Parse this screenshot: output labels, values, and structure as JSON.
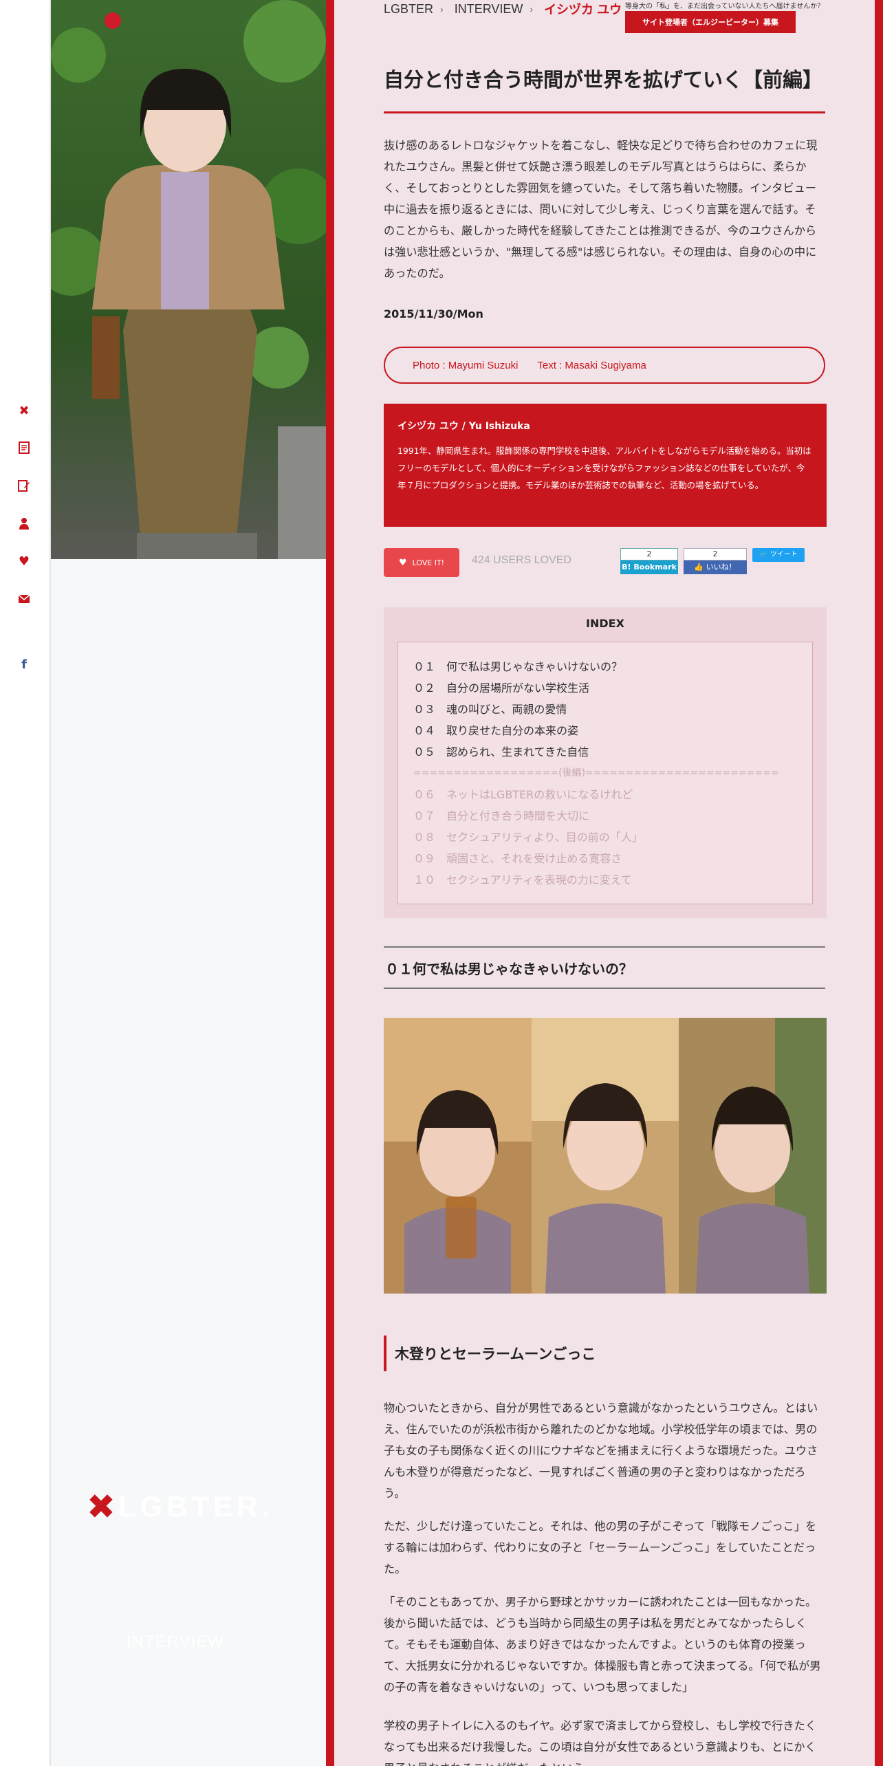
{
  "breadcrumb": {
    "home": "LGBTER",
    "section": "INTERVIEW",
    "current": "イシヅカ ユウ"
  },
  "banner": {
    "tagline": "等身大の「私」を、まだ出会っていない人たちへ届けませんか？",
    "button_label": "サイト登場者（エルジービーター）募集"
  },
  "article": {
    "title": "自分と付き合う時間が世界を拡げていく【前編】",
    "lead": "抜け感のあるレトロなジャケットを着こなし、軽快な足どりで待ち合わせのカフェに現れたユウさん。黒髪と併せて妖艶さ漂う眼差しのモデル写真とはうらはらに、柔らかく、そしておっとりとした雰囲気を纏っていた。そして落ち着いた物腰。インタビュー中に過去を振り返るときには、問いに対して少し考え、じっくり言葉を選んで話す。そのことからも、厳しかった時代を経験してきたことは推測できるが、今のユウさんからは強い悲壮感というか、\"無理してる感\"は感じられない。その理由は、自身の心の中にあったのだ。",
    "date": "2015/11/30/Mon",
    "photo_credit": "Photo : Mayumi Suzuki",
    "text_credit": "Text : Masaki Sugiyama"
  },
  "profile": {
    "name": "イシヅカ ユウ / Yu Ishizuka",
    "bio": "1991年、静岡県生まれ。服飾関係の専門学校を中退後、アルバイトをしながらモデル活動を始める。当初はフリーのモデルとして、個人的にオーディションを受けながらファッション誌などの仕事をしていたが、今年７月にプロダクションと提携。モデル業のほか芸術誌での執筆など、活動の場を拡げている。"
  },
  "reactions": {
    "love_label": "LOVE IT!",
    "loved_count": "424 USERS LOVED",
    "hatena_count": "2",
    "hatena_label": "B! Bookmark",
    "fb_count": "2",
    "fb_label": "いいね！",
    "tweet_label": "ツイート"
  },
  "index": {
    "heading": "INDEX",
    "items": [
      "０１　何で私は男じゃなきゃいけないの？",
      "０２　自分の居場所がない学校生活",
      "０３　魂の叫びと、両親の愛情",
      "０４　取り戻せた自分の本来の姿",
      "０５　認められ、生まれてきた自信",
      "==================(後編)========================",
      "０６　ネットはLGBTERの救いになるけれど",
      "０７　自分と付き合う時間を大切に",
      "０８　セクシュアリティより、目の前の「人」",
      "０９　頑固さと、それを受け止める寛容さ",
      "１０　セクシュアリティを表現の力に変えて"
    ]
  },
  "section1": {
    "heading": "０１何で私は男じゃなきゃいけないの？",
    "subheading": "木登りとセーラームーンごっこ",
    "p1": "物心ついたときから、自分が男性であるという意識がなかったというユウさん。とはいえ、住んでいたのが浜松市街から離れたのどかな地域。小学校低学年の頃までは、男の子も女の子も関係なく近くの川にウナギなどを捕まえに行くような環境だった。ユウさんも木登りが得意だったなど、一見すればごく普通の男の子と変わりはなかっただろう。",
    "p2": "ただ、少しだけ違っていたこと。それは、他の男の子がこぞって「戦隊モノごっこ」をする輪には加わらず、代わりに女の子と「セーラームーンごっこ」をしていたことだった。",
    "p3": "「そのこともあってか、男子から野球とかサッカーに誘われたことは一回もなかった。後から聞いた話では、どうも当時から同級生の男子は私を男だとみてなかったらしくて。そもそも運動自体、あまり好きではなかったんですよ。というのも体育の授業って、大抵男女に分かれるじゃないですか。体操服も青と赤って決まってる。「何で私が男の子の青を着なきゃいけないの」って、いつも思ってました」",
    "p4": "学校の男子トイレに入るのもイヤ。必ず家で済ましてから登校し、もし学校で行きたくなっても出来るだけ我慢した。この頃は自分が女性であるという意識よりも、とにかく男子と見なされることが嫌だったという。"
  },
  "sidebar": {
    "logo_text": "LGBTER.",
    "category": "INTERVIEW"
  },
  "colors": {
    "brand": "#c8161e",
    "bg": "#f2e3e8"
  }
}
